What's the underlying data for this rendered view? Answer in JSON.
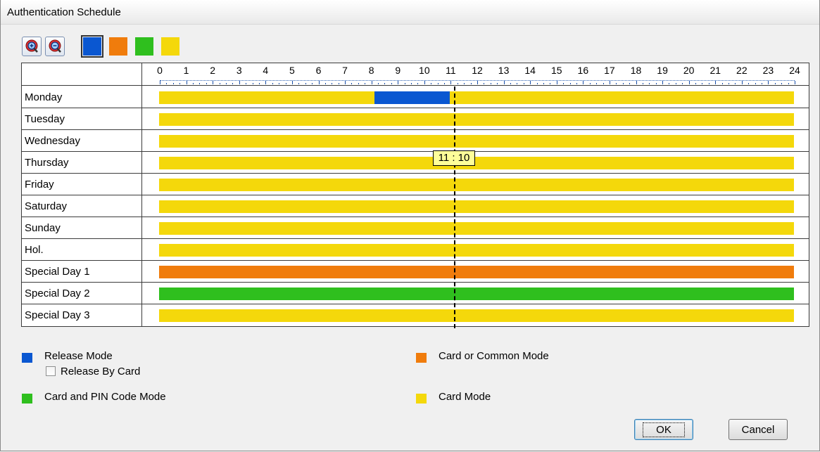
{
  "window": {
    "title": "Authentication Schedule"
  },
  "toolbar": {
    "zoom_in_icon": "zoom-in-icon",
    "zoom_out_icon": "zoom-out-icon",
    "colors": [
      {
        "name": "release-mode",
        "color": "#0a57d1",
        "selected": true
      },
      {
        "name": "card-or-common-mode",
        "color": "#f07c0c"
      },
      {
        "name": "card-and-pin-mode",
        "color": "#2fbf1e"
      },
      {
        "name": "card-mode",
        "color": "#f4d80b"
      }
    ]
  },
  "schedule": {
    "hours": [
      "0",
      "1",
      "2",
      "3",
      "4",
      "5",
      "6",
      "7",
      "8",
      "9",
      "10",
      "11",
      "12",
      "13",
      "14",
      "15",
      "16",
      "17",
      "18",
      "19",
      "20",
      "21",
      "22",
      "23",
      "24"
    ],
    "cursor_time": "11 : 10",
    "rows": [
      {
        "day": "Monday",
        "segments": [
          {
            "mode": "card",
            "start": 0,
            "end": 8.15
          },
          {
            "mode": "release",
            "start": 8.15,
            "end": 11
          },
          {
            "mode": "card",
            "start": 11,
            "end": 24
          }
        ]
      },
      {
        "day": "Tuesday",
        "segments": [
          {
            "mode": "card",
            "start": 0,
            "end": 24
          }
        ]
      },
      {
        "day": "Wednesday",
        "segments": [
          {
            "mode": "card",
            "start": 0,
            "end": 24
          }
        ]
      },
      {
        "day": "Thursday",
        "segments": [
          {
            "mode": "card",
            "start": 0,
            "end": 24
          }
        ]
      },
      {
        "day": "Friday",
        "segments": [
          {
            "mode": "card",
            "start": 0,
            "end": 24
          }
        ]
      },
      {
        "day": "Saturday",
        "segments": [
          {
            "mode": "card",
            "start": 0,
            "end": 24
          }
        ]
      },
      {
        "day": "Sunday",
        "segments": [
          {
            "mode": "card",
            "start": 0,
            "end": 24
          }
        ]
      },
      {
        "day": "Hol.",
        "segments": [
          {
            "mode": "card",
            "start": 0,
            "end": 24
          }
        ]
      },
      {
        "day": "Special Day 1",
        "segments": [
          {
            "mode": "card_or_common",
            "start": 0,
            "end": 24
          }
        ]
      },
      {
        "day": "Special Day 2",
        "segments": [
          {
            "mode": "card_and_pin",
            "start": 0,
            "end": 24
          }
        ]
      },
      {
        "day": "Special Day 3",
        "segments": [
          {
            "mode": "card",
            "start": 0,
            "end": 24
          }
        ]
      }
    ]
  },
  "mode_colors": {
    "release": "#0a57d1",
    "card_or_common": "#f07c0c",
    "card_and_pin": "#2fbf1e",
    "card": "#f4d80b"
  },
  "legend": {
    "release_mode": "Release Mode",
    "release_by_card": "Release By Card",
    "card_and_pin": "Card and PIN Code Mode",
    "card_or_common": "Card or Common Mode",
    "card_mode": "Card Mode"
  },
  "buttons": {
    "ok": "OK",
    "cancel": "Cancel"
  }
}
